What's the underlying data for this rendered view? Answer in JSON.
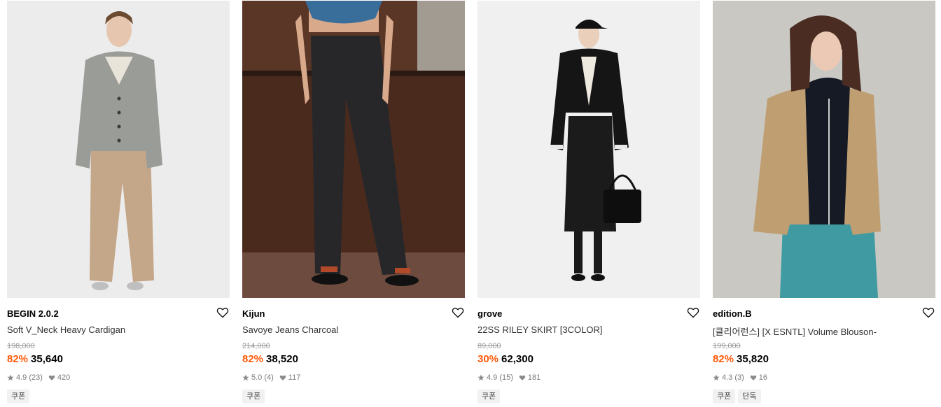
{
  "products": [
    {
      "brand": "BEGIN 2.0.2",
      "name": "Soft V_Neck Heavy Cardigan",
      "original_price": "198,000",
      "discount": "82%",
      "price": "35,640",
      "rating": "4.9 (23)",
      "likes": "420",
      "badges": [
        "쿠폰"
      ],
      "image_desc": "model-gray-cardigan-beige-pants"
    },
    {
      "brand": "Kijun",
      "name": "Savoye Jeans Charcoal",
      "original_price": "214,000",
      "discount": "82%",
      "price": "38,520",
      "rating": "5.0 (4)",
      "likes": "117",
      "badges": [
        "쿠폰"
      ],
      "image_desc": "model-charcoal-jeans-wood-background"
    },
    {
      "brand": "grove",
      "name": "22SS RILEY SKIRT [3COLOR]",
      "original_price": "89,000",
      "discount": "30%",
      "price": "62,300",
      "rating": "4.9 (15)",
      "likes": "181",
      "badges": [
        "쿠폰"
      ],
      "image_desc": "model-black-jacket-skirt-handbag"
    },
    {
      "brand": "edition.B",
      "name": "[클리어런스] [X ESNTL] Volume Blouson-",
      "original_price": "199,000",
      "discount": "82%",
      "price": "35,820",
      "rating": "4.3 (3)",
      "likes": "16",
      "badges": [
        "쿠폰",
        "단독"
      ],
      "image_desc": "model-beige-blouson-teal-pants"
    }
  ],
  "colors": {
    "discount": "#ff5a0a",
    "meta_gray": "#7a7a7a",
    "strike_gray": "#9a9a9a",
    "badge_bg": "#f1f1f1"
  },
  "icons": {
    "wish": "heart-outline-icon",
    "rating": "star-icon",
    "likes": "heart-filled-icon"
  }
}
